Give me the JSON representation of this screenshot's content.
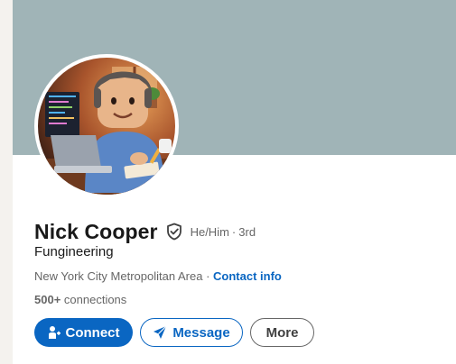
{
  "profile": {
    "name": "Nick Cooper",
    "pronouns": "He/Him",
    "separator": "·",
    "degree": "3rd",
    "headline": "Fungineering",
    "location": "New York City Metropolitan Area",
    "location_separator": "·",
    "contact_info_label": "Contact info",
    "connections_count": "500+",
    "connections_label": "connections"
  },
  "actions": {
    "connect_label": "Connect",
    "message_label": "Message",
    "more_label": "More"
  },
  "colors": {
    "banner": "#a0b4b7",
    "accent": "#0a66c2",
    "text_primary": "#191919",
    "text_secondary": "#666666",
    "page_bg": "#f4f2ee"
  },
  "icons": {
    "verified": "shield-check-icon",
    "connect": "add-person-icon",
    "message": "send-icon"
  }
}
